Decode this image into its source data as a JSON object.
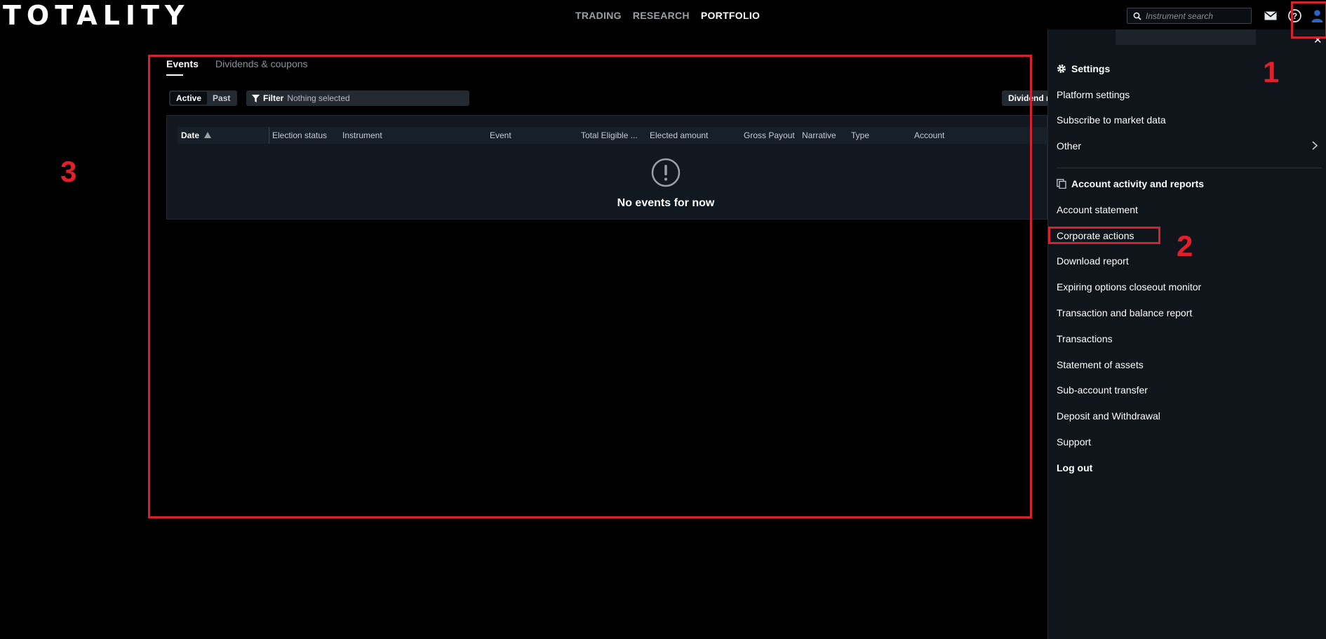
{
  "header": {
    "logo": "TOTALITY",
    "nav": [
      {
        "label": "TRADING",
        "active": false
      },
      {
        "label": "RESEARCH",
        "active": false
      },
      {
        "label": "PORTFOLIO",
        "active": true
      }
    ],
    "search_placeholder": "Instrument search",
    "icons": [
      "mail-icon",
      "help-icon",
      "user-icon"
    ]
  },
  "main": {
    "tabs": [
      {
        "label": "Events",
        "active": true
      },
      {
        "label": "Dividends & coupons",
        "active": false
      }
    ],
    "toggle": {
      "active": "Active",
      "past": "Past"
    },
    "filter": {
      "label": "Filter",
      "value": "Nothing selected"
    },
    "dividend_button": "Dividend r",
    "columns": [
      "Date",
      "Election status",
      "Instrument",
      "Event",
      "Total Eligible ...",
      "Elected amount",
      "Gross Payout",
      "Narrative",
      "Type",
      "Account"
    ],
    "empty_message": "No events for now"
  },
  "menu": {
    "settings_heading": "Settings",
    "settings_items": [
      "Platform settings",
      "Subscribe to market data",
      "Other"
    ],
    "reports_heading": "Account activity and reports",
    "reports_items": [
      "Account statement",
      "Corporate actions",
      "Download report",
      "Expiring options closeout monitor",
      "Transaction and balance report",
      "Transactions",
      "Statement of assets",
      "Sub-account transfer",
      "Deposit and Withdrawal",
      "Support"
    ],
    "logout": "Log out"
  },
  "annotations": {
    "one": "1",
    "two": "2",
    "three": "3"
  },
  "colors": {
    "background": "#000000",
    "panel": "#0f151b",
    "table": "#111820",
    "annotation": "#d6222e"
  }
}
